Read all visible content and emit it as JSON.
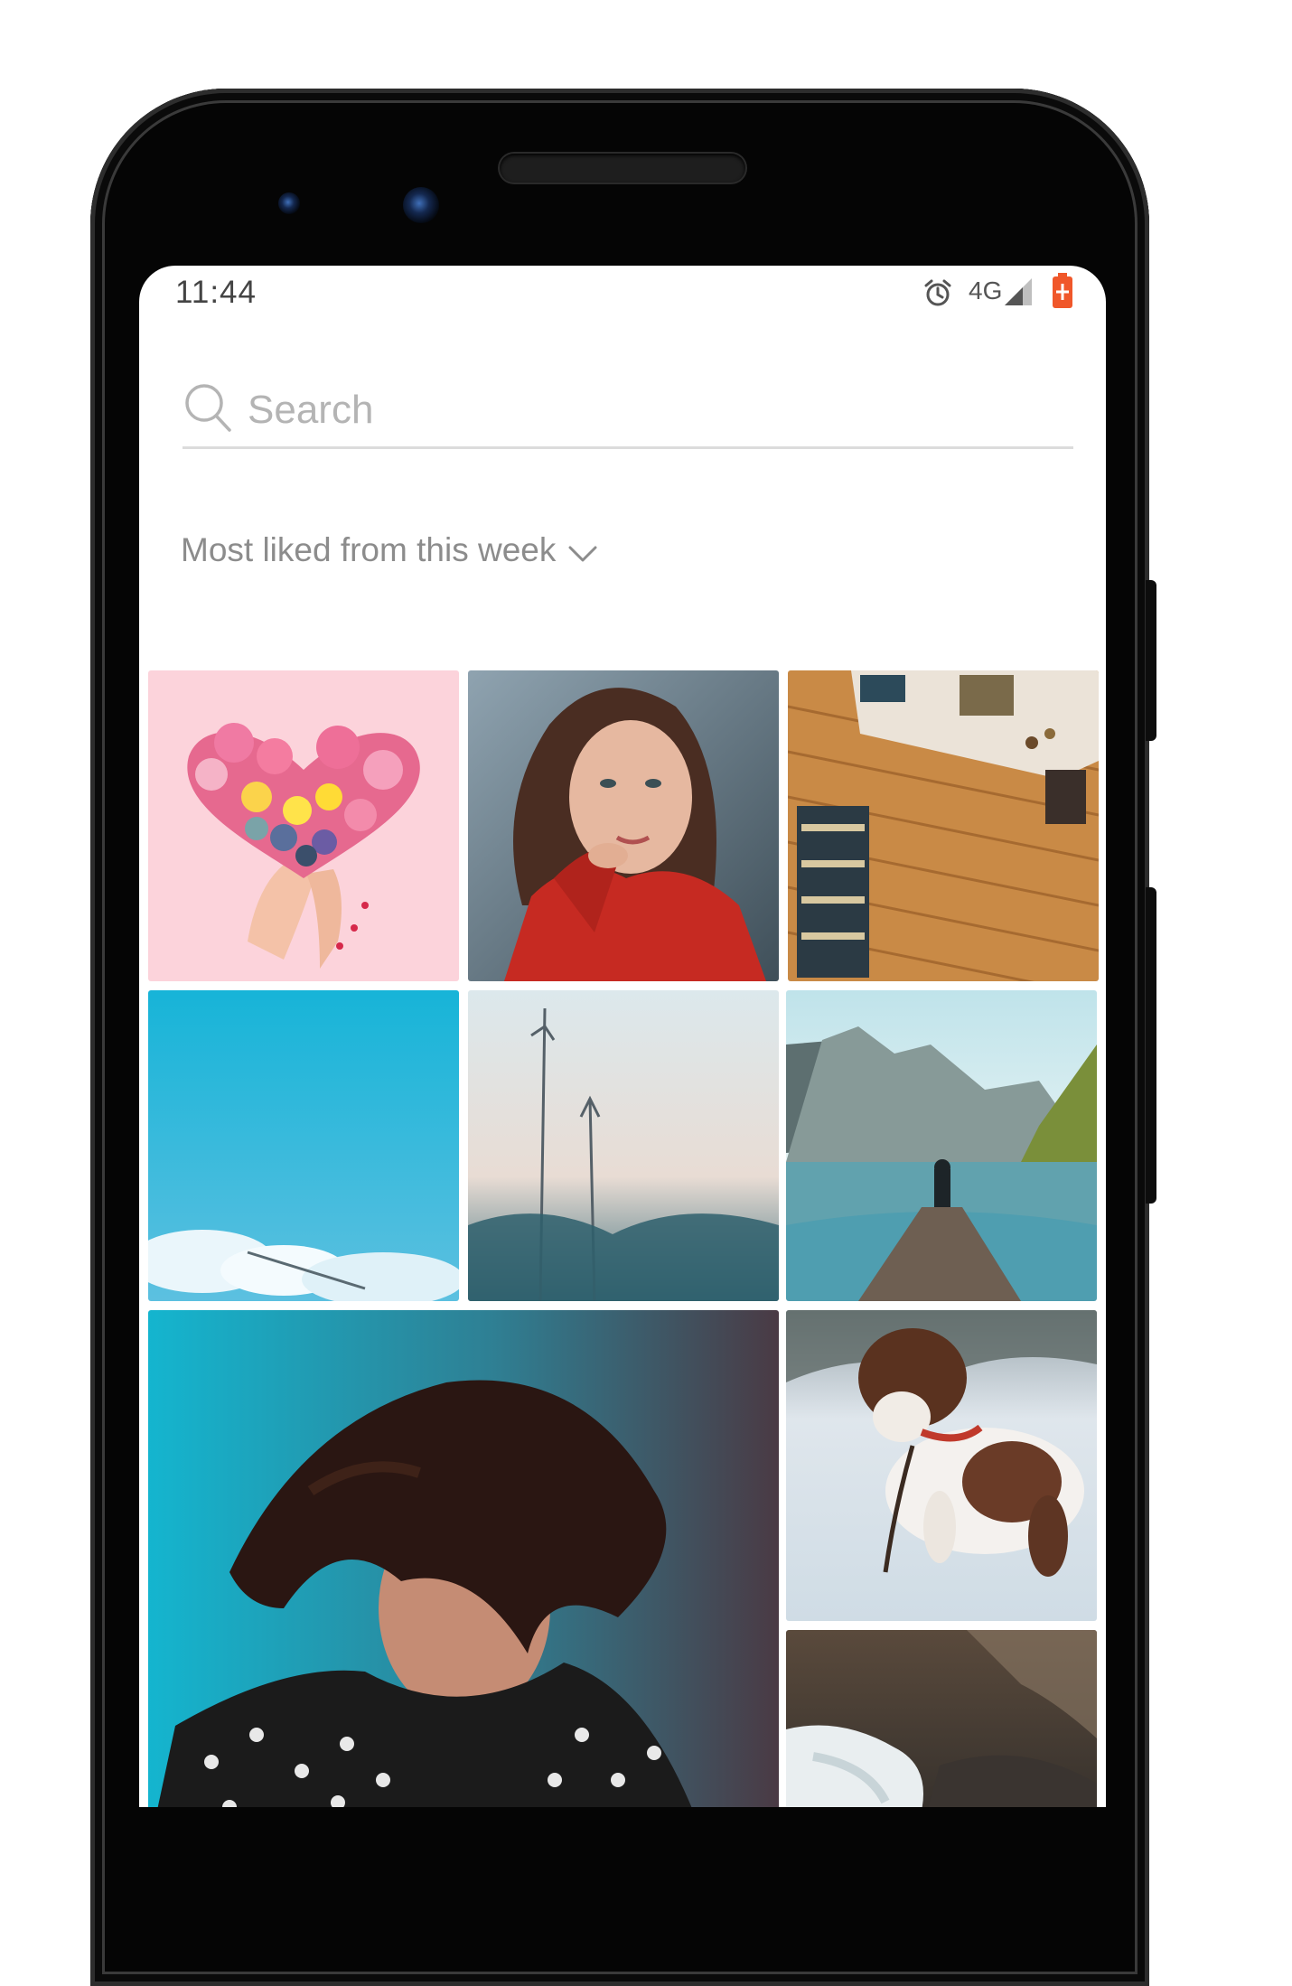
{
  "status_bar": {
    "time": "11:44",
    "network": "4G",
    "battery_color": "#f0572a"
  },
  "search": {
    "placeholder": "Search",
    "value": ""
  },
  "filter": {
    "label": "Most liked from this week"
  },
  "photos": [
    {
      "subject": "flower-heart"
    },
    {
      "subject": "woman-red-jacket"
    },
    {
      "subject": "store-clothing-rack"
    },
    {
      "subject": "blue-sky-clouds"
    },
    {
      "subject": "grass-silhouette"
    },
    {
      "subject": "lake-pier-mountains"
    },
    {
      "subject": "woman-windblown-hair"
    },
    {
      "subject": "dog-in-snow"
    },
    {
      "subject": "waterfall-rocks"
    }
  ]
}
